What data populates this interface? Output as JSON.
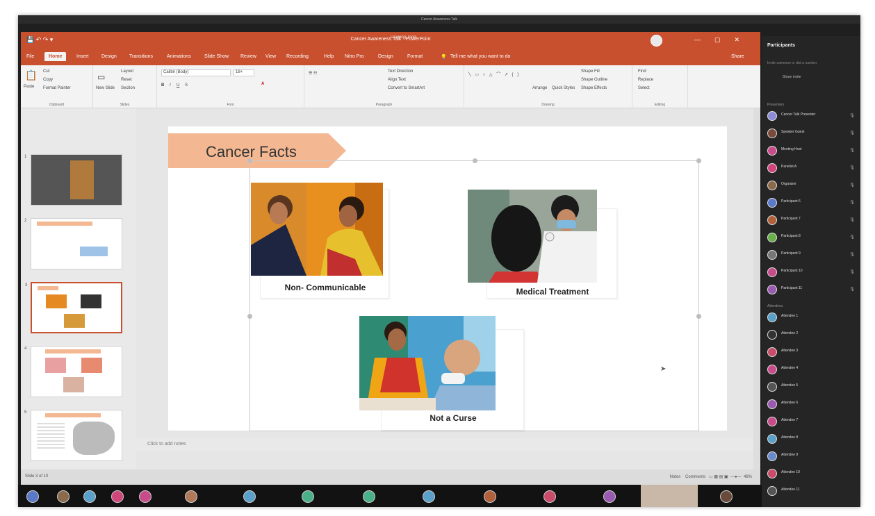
{
  "window": {
    "title": "Cancer Awareness Talk - PowerPoint",
    "meeting_title": "Cancer Awareness Talk",
    "context_tab": "Drawing Tools"
  },
  "ribbon_tabs": [
    "File",
    "Home",
    "Insert",
    "Design",
    "Transitions",
    "Animations",
    "Slide Show",
    "Review",
    "View",
    "Recording",
    "Help",
    "Nitro Pro",
    "Design",
    "Format"
  ],
  "tell_me": "Tell me what you want to do",
  "share_label": "Share",
  "ribbon_groups": {
    "clipboard": {
      "label": "Clipboard",
      "paste": "Paste",
      "cut": "Cut",
      "copy": "Copy",
      "format_painter": "Format Painter"
    },
    "slides": {
      "label": "Slides",
      "new_slide": "New Slide",
      "layout": "Layout",
      "reset": "Reset",
      "section": "Section"
    },
    "font": {
      "label": "Font",
      "font_name": "Calibri (Body)",
      "font_size": "18+"
    },
    "paragraph": {
      "label": "Paragraph",
      "text_direction": "Text Direction",
      "align_text": "Align Text",
      "smartart": "Convert to SmartArt"
    },
    "drawing": {
      "label": "Drawing",
      "arrange": "Arrange",
      "quick_styles": "Quick Styles",
      "fill": "Shape Fill",
      "outline": "Shape Outline",
      "effects": "Shape Effects"
    },
    "editing": {
      "label": "Editing",
      "find": "Find",
      "replace": "Replace",
      "select": "Select"
    }
  },
  "slide": {
    "title": "Cancer Facts",
    "captions": [
      "Non- Communicable",
      "Medical Treatment",
      "Not a Curse"
    ]
  },
  "thumbnails": [
    "1",
    "2",
    "3",
    "4",
    "5"
  ],
  "notes_placeholder": "Click to add notes",
  "status": {
    "slide_counter": "Slide 3 of 10",
    "notes": "Notes",
    "comments": "Comments",
    "zoom": "48%"
  },
  "participants": {
    "header": "Participants",
    "search": "Invite someone or dial a number",
    "share_invite": "Share invite",
    "presenters_label": "Presenters",
    "attendees_label": "Attendees",
    "people": [
      "Cancer Talk Presenter",
      "Speaker Guest",
      "Meeting Host",
      "Panelist A",
      "Organizer",
      "Participant 6",
      "Participant 7",
      "Participant 8",
      "Participant 9",
      "Participant 10",
      "Participant 11",
      "Attendee 1",
      "Attendee 2",
      "Attendee 3",
      "Attendee 4",
      "Attendee 5",
      "Attendee 6",
      "Attendee 7",
      "Attendee 8",
      "Attendee 9",
      "Attendee 10",
      "Attendee 11"
    ]
  },
  "colors": {
    "accent": "#c9502f",
    "banner": "#f3b892",
    "panel": "#252525"
  }
}
